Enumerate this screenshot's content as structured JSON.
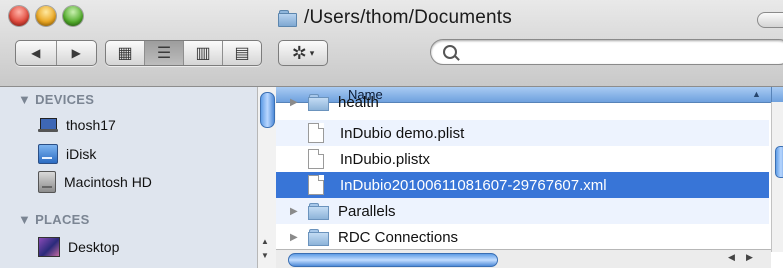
{
  "window": {
    "path": "/Users/thom/Documents"
  },
  "toolbar": {
    "back": "◀",
    "forward": "▶",
    "view_icons": "▦",
    "view_list": "☰",
    "view_columns": "▥",
    "view_coverflow": "▤",
    "action_icon": "✲",
    "action_caret": "▾",
    "search_placeholder": ""
  },
  "sidebar": {
    "devices_header": "▼ DEVICES",
    "devices": [
      {
        "label": "thosh17",
        "icon": "laptop-icon"
      },
      {
        "label": "iDisk",
        "icon": "idisk-icon"
      },
      {
        "label": "Macintosh HD",
        "icon": "hard-drive-icon"
      }
    ],
    "places_header": "▼ PLACES",
    "places": [
      {
        "label": "Desktop",
        "icon": "desktop-icon"
      }
    ]
  },
  "list": {
    "column_name": "Name",
    "sort_indicator": "▲",
    "rows": [
      {
        "label": "health",
        "type": "folder"
      },
      {
        "label": "InDubio demo.plist",
        "type": "file"
      },
      {
        "label": "InDubio.plistx",
        "type": "file"
      },
      {
        "label": "InDubio20100611081607-29767607.xml",
        "type": "file",
        "selected": true
      },
      {
        "label": "Parallels",
        "type": "folder"
      },
      {
        "label": "RDC Connections",
        "type": "folder"
      }
    ]
  },
  "colors": {
    "selection": "#3875d7",
    "sidebar_bg": "#dfe5ee",
    "header_blue": "#6fa1de"
  }
}
